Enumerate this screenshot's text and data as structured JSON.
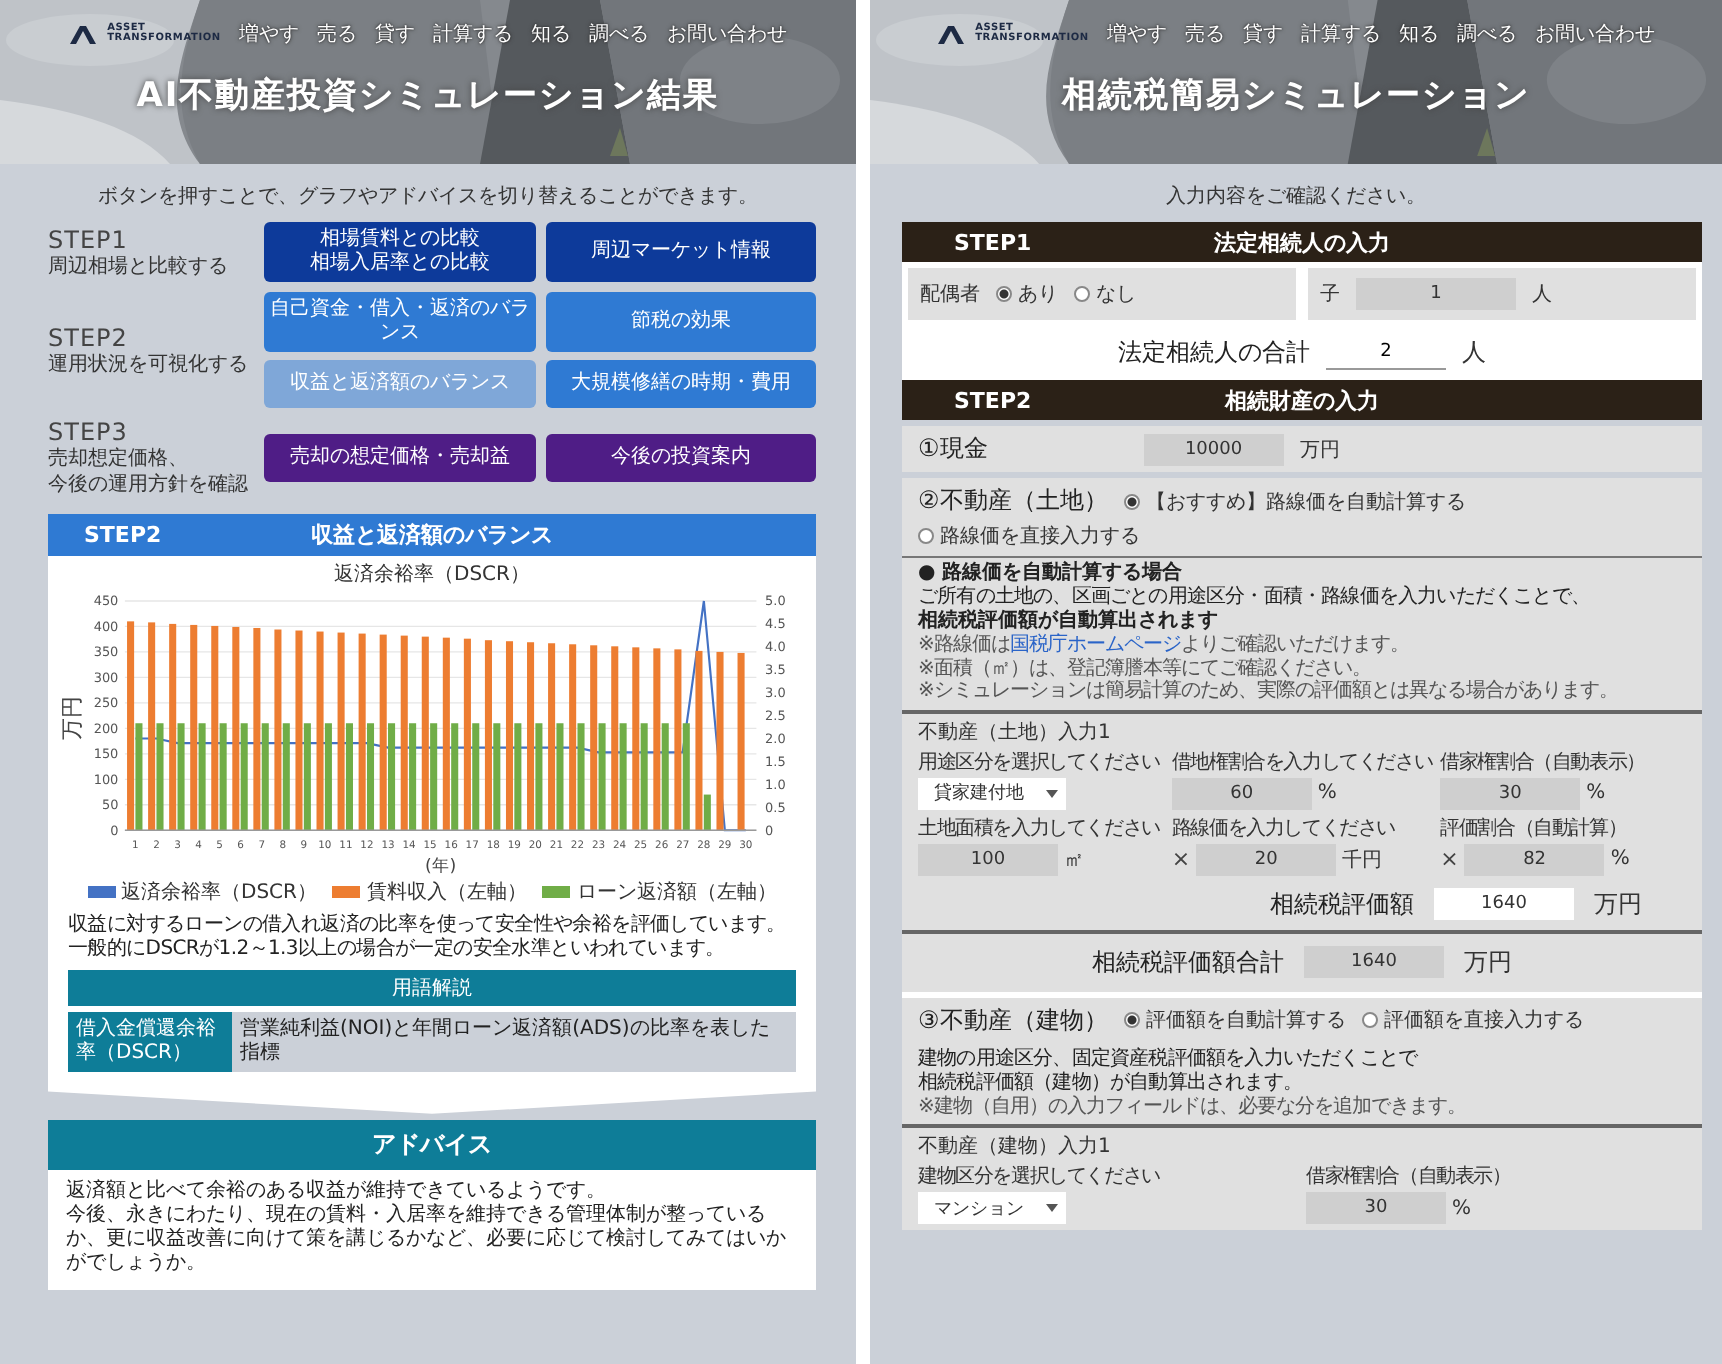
{
  "left_page": {
    "header": {
      "logo": [
        "ASSET",
        "TRANSFORMATION"
      ],
      "nav": [
        "増やす",
        "売る",
        "貸す",
        "計算する",
        "知る",
        "調べる",
        "お問い合わせ"
      ]
    },
    "title": "AI不動産投資シミュレーション結果",
    "intro": "ボタンを押すことで、グラフやアドバイスを切り替えることができます。",
    "steps": [
      {
        "label": "STEP1",
        "description": [
          "周辺相場と比較する"
        ],
        "color": "#0d3a9a",
        "buttons": [
          {
            "lines": [
              "相場賃料との比較",
              "相場入居率との比較"
            ],
            "selected": false
          },
          {
            "lines": [
              "周辺マーケット情報"
            ],
            "selected": false
          }
        ]
      },
      {
        "label": "STEP2",
        "description": [
          "運用状況を可視化する"
        ],
        "color": "#2f7ad3",
        "buttons": [
          {
            "lines": [
              "自己資金・借入・返済のバランス"
            ],
            "selected": false
          },
          {
            "lines": [
              "節税の効果"
            ],
            "selected": false
          },
          {
            "lines": [
              "収益と返済額のバランス"
            ],
            "selected": true
          },
          {
            "lines": [
              "大規模修繕の時期・費用"
            ],
            "selected": false
          }
        ]
      },
      {
        "label": "STEP3",
        "description": [
          "売却想定価格、",
          "今後の運用方針を確認"
        ],
        "color": "#4f1d86",
        "buttons": [
          {
            "lines": [
              "売却の想定価格・売却益"
            ],
            "selected": false
          },
          {
            "lines": [
              "今後の投資案内"
            ],
            "selected": false
          }
        ]
      }
    ],
    "result": {
      "step": "STEP2",
      "title": "収益と返済額のバランス",
      "chart_data": {
        "type": "bar",
        "title": "返済余裕率（DSCR）",
        "xlabel": "(年)",
        "ylabel": "万円",
        "grid": true,
        "legend": "bottom",
        "categories": [
          "1",
          "2",
          "3",
          "4",
          "5",
          "6",
          "7",
          "8",
          "9",
          "10",
          "11",
          "12",
          "13",
          "14",
          "15",
          "16",
          "17",
          "18",
          "19",
          "20",
          "21",
          "22",
          "23",
          "24",
          "25",
          "26",
          "27",
          "28",
          "29",
          "30"
        ],
        "ylim": [
          0,
          450
        ],
        "yticks": [
          0,
          50,
          100,
          150,
          200,
          250,
          300,
          350,
          400,
          450
        ],
        "y2lim": [
          0,
          5
        ],
        "y2ticks": [
          0,
          0.5,
          {
            "value": 1,
            "label": "1.0"
          },
          1.5,
          {
            "value": 2,
            "label": "2.0"
          },
          2.5,
          {
            "value": 3,
            "label": "3.0"
          },
          3.5,
          {
            "value": 4,
            "label": "4.0"
          },
          4.5,
          {
            "value": 5,
            "label": "5.0"
          }
        ],
        "series": [
          {
            "name": "返済余裕率（DSCR）",
            "type": "line",
            "axis": "y2",
            "color": "#4472c4",
            "values": [
              2.0,
              2.0,
              1.9,
              1.9,
              1.9,
              1.9,
              1.9,
              1.9,
              1.9,
              1.9,
              1.9,
              1.9,
              1.8,
              1.8,
              1.8,
              1.8,
              1.8,
              1.8,
              1.8,
              1.8,
              1.8,
              1.8,
              1.7,
              1.7,
              1.7,
              1.7,
              1.7,
              5.0,
              0,
              0
            ]
          },
          {
            "name": "賃料収入（左軸）",
            "type": "bar",
            "color": "#ed7d31",
            "values": [
              410,
              408,
              405,
              403,
              401,
              399,
              397,
              394,
              392,
              390,
              388,
              386,
              384,
              382,
              380,
              378,
              376,
              373,
              371,
              369,
              367,
              365,
              363,
              361,
              359,
              357,
              355,
              352,
              350,
              348
            ]
          },
          {
            "name": "ローン返済額（左軸）",
            "type": "bar",
            "color": "#70ad47",
            "values": [
              210,
              210,
              210,
              210,
              210,
              210,
              210,
              210,
              210,
              210,
              210,
              210,
              210,
              210,
              210,
              210,
              210,
              210,
              210,
              210,
              210,
              210,
              210,
              210,
              210,
              210,
              210,
              70,
              0,
              0
            ]
          }
        ]
      },
      "note": [
        "収益に対するローンの借入れ返済の比率を使って安全性や余裕を評価しています。",
        "一般的にDSCRが1.2～1.3以上の場合が一定の安全水準といわれています。"
      ],
      "glossary": {
        "heading": "用語解説",
        "term": "借入金償還余裕率（DSCR）",
        "definition": "営業純利益(NOI)と年間ローン返済額(ADS)の比率を表した指標"
      }
    },
    "advice": {
      "heading": "アドバイス",
      "paragraphs": [
        "返済額と比べて余裕のある収益が維持できているようです。",
        "今後、永きにわたり、現在の賃料・入居率を維持できる管理体制が整っているか、更に収益改善に向けて策を講じるかなど、必要に応じて検討してみてはいかがでしょうか。"
      ]
    }
  },
  "right_page": {
    "header": {
      "logo": [
        "ASSET",
        "TRANSFORMATION"
      ],
      "nav": [
        "増やす",
        "売る",
        "貸す",
        "計算する",
        "知る",
        "調べる",
        "お問い合わせ"
      ]
    },
    "title": "相続税簡易シミュレーション",
    "intro": "入力内容をご確認ください。",
    "step1": {
      "label": "STEP1",
      "title": "法定相続人の入力",
      "spouse": {
        "label": "配偶者",
        "options": [
          {
            "label": "あり",
            "selected": true
          },
          {
            "label": "なし",
            "selected": false
          }
        ]
      },
      "children": {
        "label": "子",
        "value": "1",
        "unit": "人"
      },
      "total": {
        "label": "法定相続人の合計",
        "value": "2",
        "unit": "人"
      }
    },
    "step2": {
      "label": "STEP2",
      "title": "相続財産の入力",
      "cash": {
        "label": "①現金",
        "value": "10000",
        "unit": "万円"
      },
      "land": {
        "label": "②不動産（土地）",
        "options": [
          {
            "label": "【おすすめ】路線価を自動計算する",
            "selected": true
          },
          {
            "label": "路線価を直接入力する",
            "selected": false
          }
        ],
        "notes": {
          "heading": "● 路線価を自動計算する場合",
          "lines": [
            "ご所有の土地の、区画ごとの用途区分・面積・路線価を入力いただくことで、"
          ],
          "emphasis": "相続税評価額が自動算出されます",
          "small": [
            {
              "text": "※路線価は",
              "link": "国税庁ホームページ",
              "after": "よりご確認いただけます。"
            },
            {
              "text": "※面積（㎡）は、登記簿謄本等にてご確認ください。"
            },
            {
              "text": "※シミュレーションは簡易計算のため、実際の評価額とは異なる場合があります。"
            }
          ]
        },
        "form": {
          "title": "不動産（土地）入力1",
          "fields": [
            {
              "kind": "select",
              "label": "用途区分を選択してください",
              "value": "貸家建付地"
            },
            {
              "kind": "input",
              "label": "借地権割合を入力してください",
              "value": "60",
              "unit": "%"
            },
            {
              "kind": "input",
              "label": "借家権割合（自動表示）",
              "value": "30",
              "unit": "%"
            },
            {
              "kind": "input",
              "label": "土地面積を入力してください",
              "value": "100",
              "unit": "㎡"
            },
            {
              "kind": "input",
              "label": "路線価を入力してください",
              "prefix": "×",
              "value": "20",
              "unit": "千円"
            },
            {
              "kind": "input",
              "label": "評価割合（自動計算）",
              "prefix": "×",
              "value": "82",
              "unit": "%"
            }
          ]
        },
        "valuation": {
          "label": "相続税評価額",
          "value": "1640",
          "unit": "万円"
        }
      },
      "land_total": {
        "label": "相続税評価額合計",
        "value": "1640",
        "unit": "万円"
      },
      "building": {
        "label": "③不動産（建物）",
        "options": [
          {
            "label": "評価額を自動計算する",
            "selected": true
          },
          {
            "label": "評価額を直接入力する",
            "selected": false
          }
        ],
        "notes": {
          "lines": [
            "建物の用途区分、固定資産税評価額を入力いただくことで",
            "相続税評価額（建物）が自動算出されます。"
          ],
          "small": [
            {
              "text": "※建物（自用）の入力フィールドは、必要な分を追加できます。"
            }
          ]
        },
        "form": {
          "title": "不動産（建物）入力1",
          "fields": [
            {
              "kind": "select",
              "label": "建物区分を選択してください",
              "value": "マンション"
            },
            {
              "kind": "input",
              "label": "借家権割合（自動表示）",
              "value": "30",
              "unit": "%"
            }
          ]
        }
      }
    }
  }
}
